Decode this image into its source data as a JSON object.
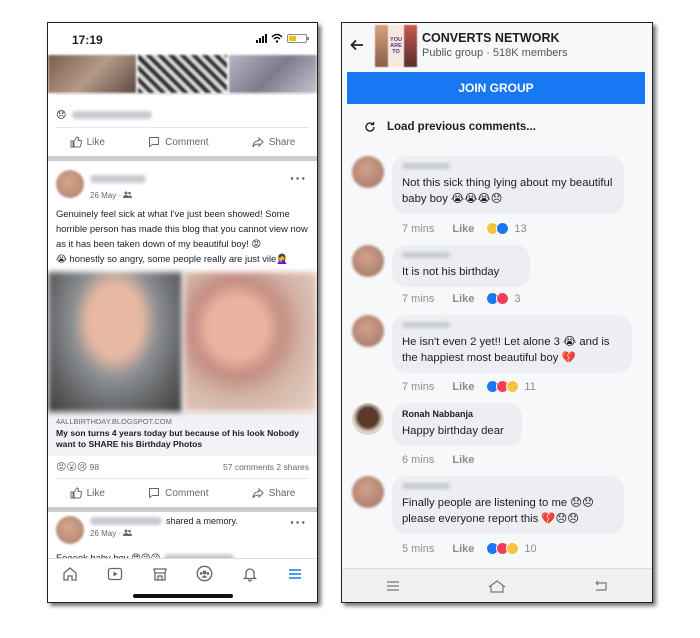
{
  "left_phone": {
    "status": {
      "time": "17:19"
    },
    "top_actions": {
      "like": "Like",
      "comment": "Comment",
      "share": "Share"
    },
    "post": {
      "date": "26 May ·",
      "text_line1": "Genuinely feel sick at what I've just been showed! Some horrible person has made this blog that you cannot view now as it has been taken down of my beautiful boy! 😡",
      "text_line2": "😭 honestly so angry, some people really are just vile🤦‍♀️",
      "link_domain": "4ALLBIRTHDAY.BLOGSPOT.COM",
      "link_title": "My son turns 4 years today but because of his look Nobody want to SHARE his Birthday Photos",
      "reaction_emojis": "😡😮😢",
      "reaction_count": "98",
      "comments_shares": "57 comments  2 shares",
      "like": "Like",
      "comment": "Comment",
      "share": "Share"
    },
    "memory_post": {
      "shared_text": "shared a memory.",
      "date": "26 May ·",
      "text": "Eeeeek baby boy 😍😘😘"
    },
    "nav_icons": [
      "home-icon",
      "video-icon",
      "marketplace-icon",
      "groups-icon",
      "bell-icon",
      "menu-icon"
    ],
    "accent_color": "#1877f2"
  },
  "right_phone": {
    "group": {
      "name": "CONVERTS NETWORK",
      "subtitle": "Public group  ·  518K members",
      "join_label": "JOIN GROUP",
      "thumb_text": "YOU ARE TO"
    },
    "load_previous": "Load previous comments...",
    "comments": [
      {
        "name": "",
        "text": "Not this sick thing lying about my beautiful baby boy 😭😭😭😞",
        "time": "7 mins",
        "like": "Like",
        "reactions": "13"
      },
      {
        "name": "",
        "text": "It is not his birthday",
        "time": "7 mins",
        "like": "Like",
        "reactions": "3"
      },
      {
        "name": "",
        "text": "He isn't even 2 yet!! Let alone 3 😭 and is the happiest most beautiful boy 💔",
        "time": "7 mins",
        "like": "Like",
        "reactions": "11"
      },
      {
        "name": "Ronah Nabbanja",
        "text": "Happy birthday dear",
        "time": "6 mins",
        "like": "Like",
        "reactions": ""
      },
      {
        "name": "",
        "text": "Finally people are listening to me 😞😞 please everyone report this 💔😞😞",
        "time": "5 mins",
        "like": "Like",
        "reactions": "10"
      }
    ],
    "join_color": "#1877f2"
  }
}
